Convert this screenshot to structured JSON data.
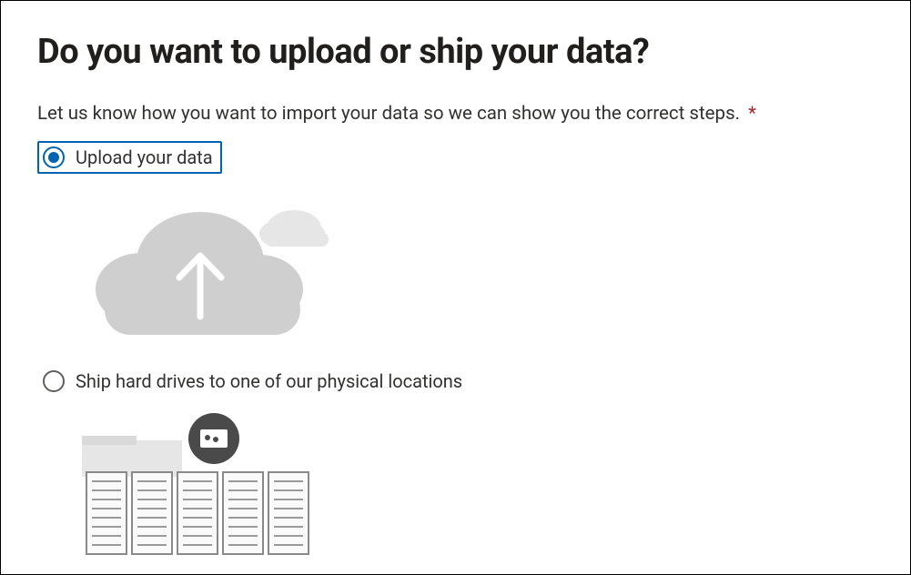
{
  "page": {
    "title": "Do you want to upload or ship your data?",
    "instruction": "Let us know how you want to import your data so we can show you the correct steps.",
    "required_mark": "*"
  },
  "options": {
    "upload": {
      "label": "Upload your data"
    },
    "ship": {
      "label": "Ship hard drives to one of our physical locations"
    }
  }
}
